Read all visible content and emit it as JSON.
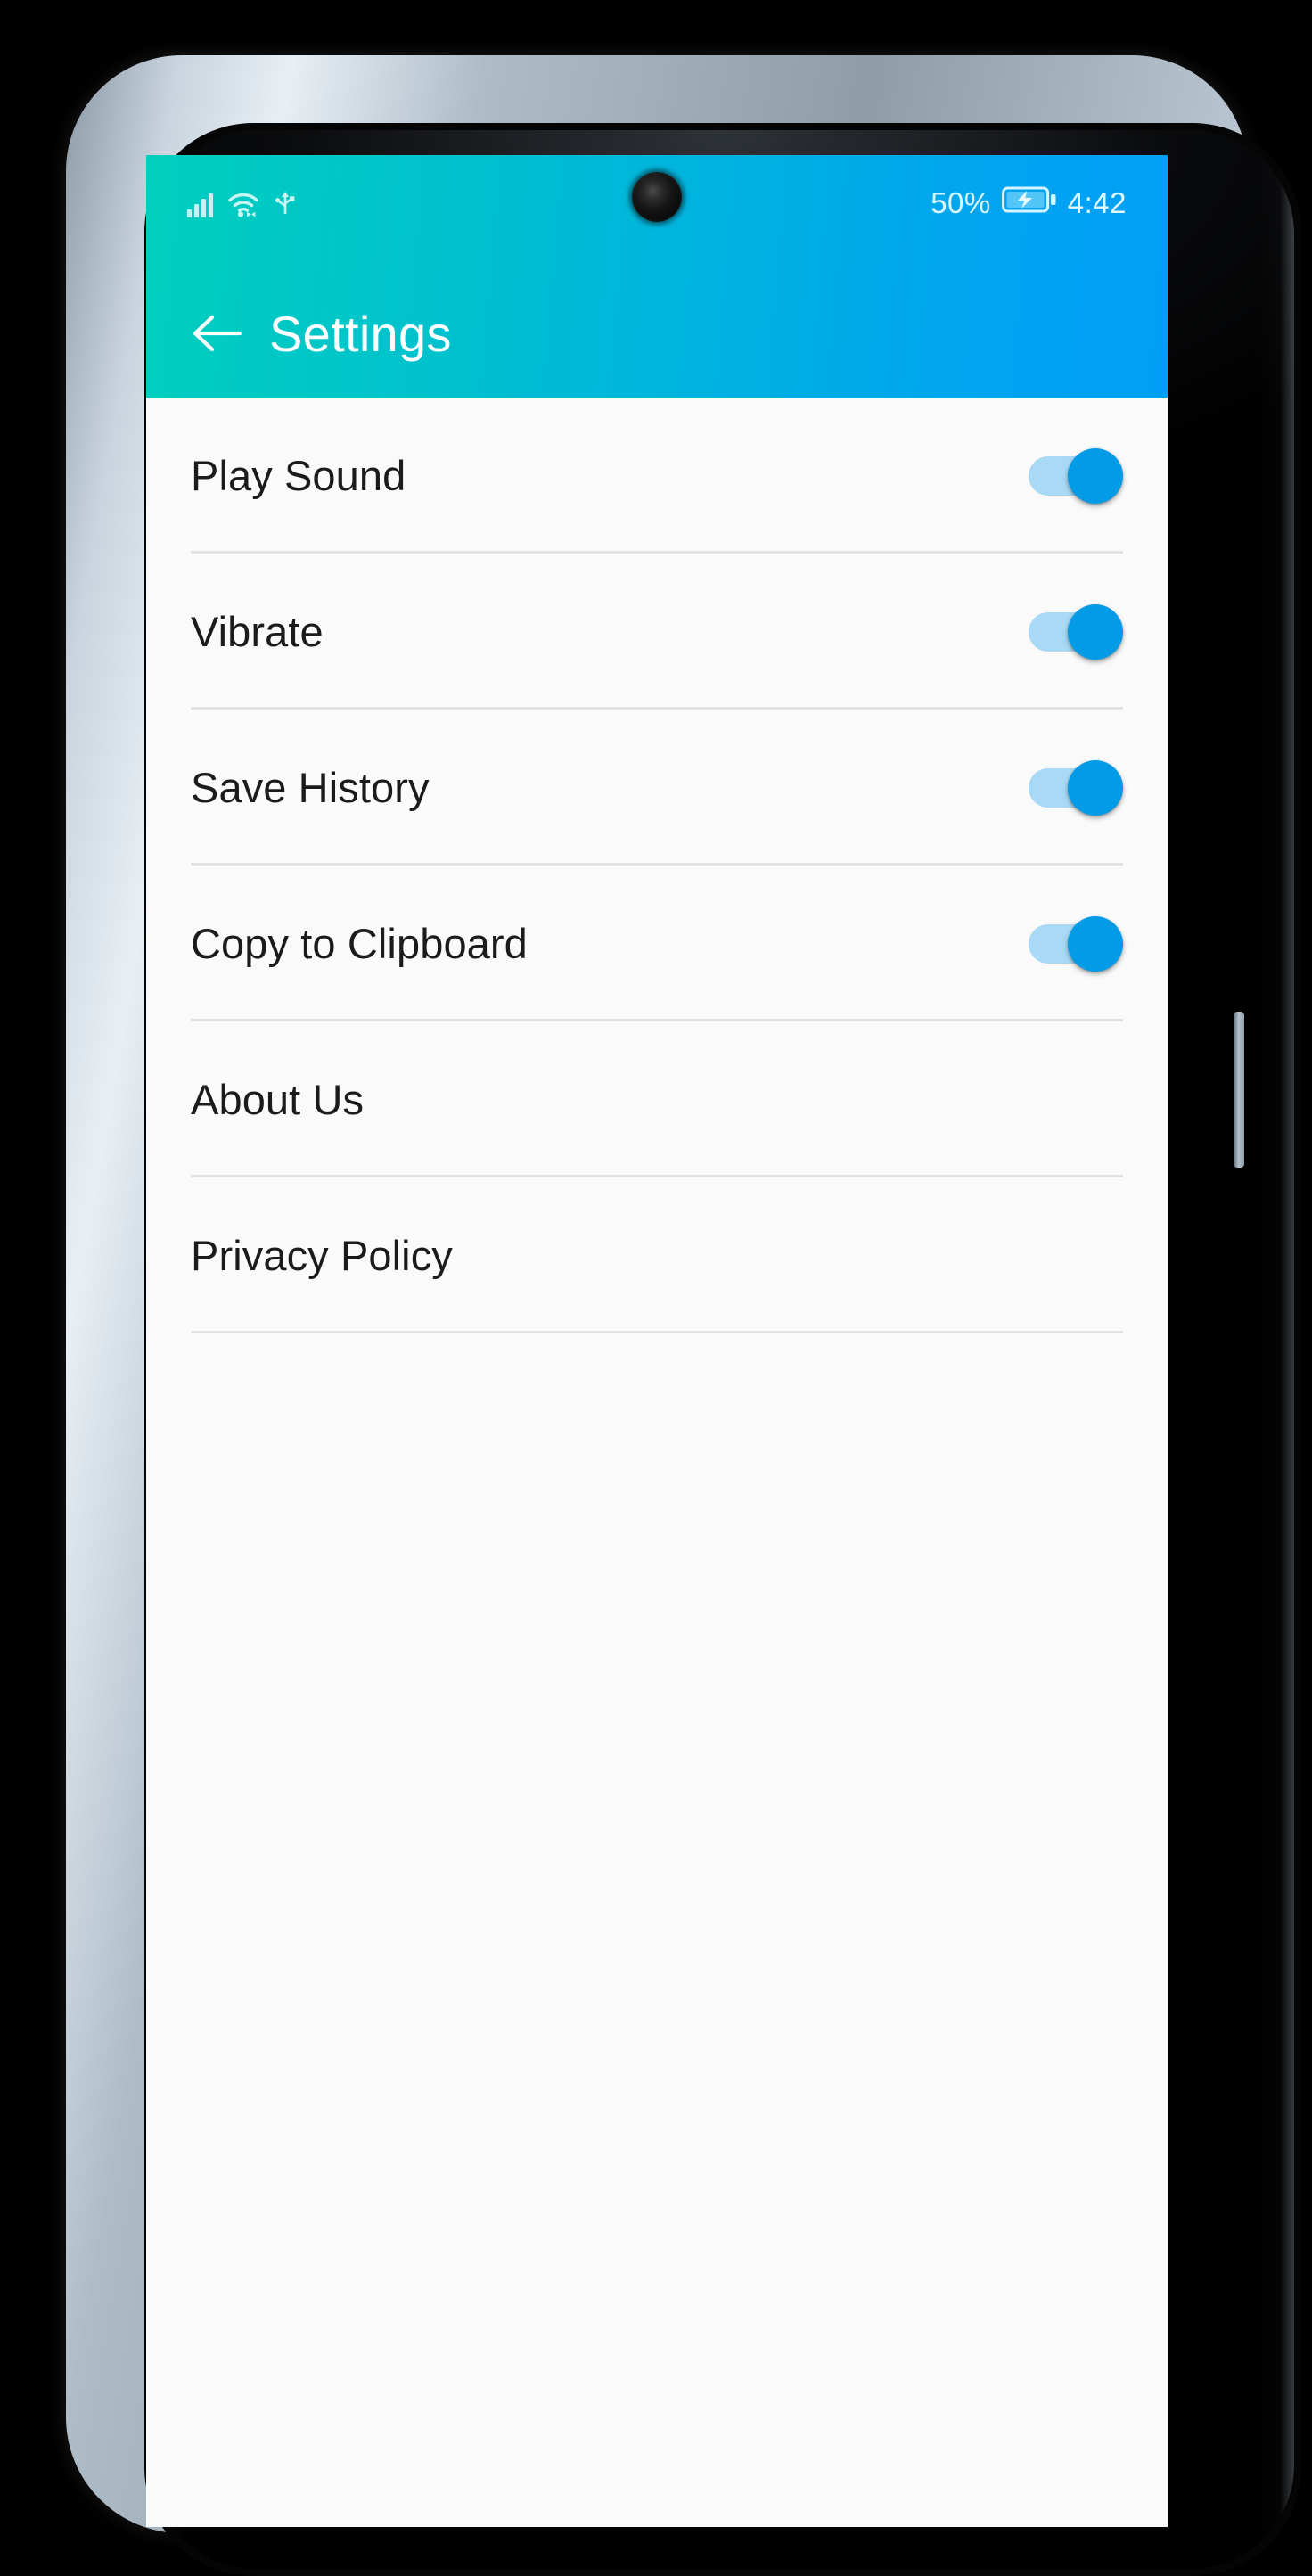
{
  "device": {
    "frame": "android-phone-mockup",
    "bezel_color": "#000000",
    "frame_color": "#aebcc8"
  },
  "status_bar": {
    "icons": [
      "signal-bars-icon",
      "wifi-icon",
      "usb-icon"
    ],
    "battery_percent": "50%",
    "battery_icon": "battery-charging-icon",
    "clock": "4:42",
    "text_color": "#e8fbff"
  },
  "app_bar": {
    "back_icon": "back-arrow-icon",
    "title": "Settings",
    "gradient_start": "#00cfbe",
    "gradient_end": "#00a2f3",
    "title_color": "#ffffff"
  },
  "theme": {
    "page_background": "#fafafa",
    "divider_color": "#e2e2e2",
    "label_color": "#1b1b1b",
    "switch_thumb_on": "#039be5",
    "switch_track_on": "#a8daf6"
  },
  "settings_list": [
    {
      "label": "Play Sound",
      "type": "switch",
      "value": "on"
    },
    {
      "label": "Vibrate",
      "type": "switch",
      "value": "on"
    },
    {
      "label": "Save History",
      "type": "switch",
      "value": "on"
    },
    {
      "label": "Copy to Clipboard",
      "type": "switch",
      "value": "on"
    },
    {
      "label": "About Us",
      "type": "link",
      "value": ""
    },
    {
      "label": "Privacy Policy",
      "type": "link",
      "value": ""
    }
  ]
}
